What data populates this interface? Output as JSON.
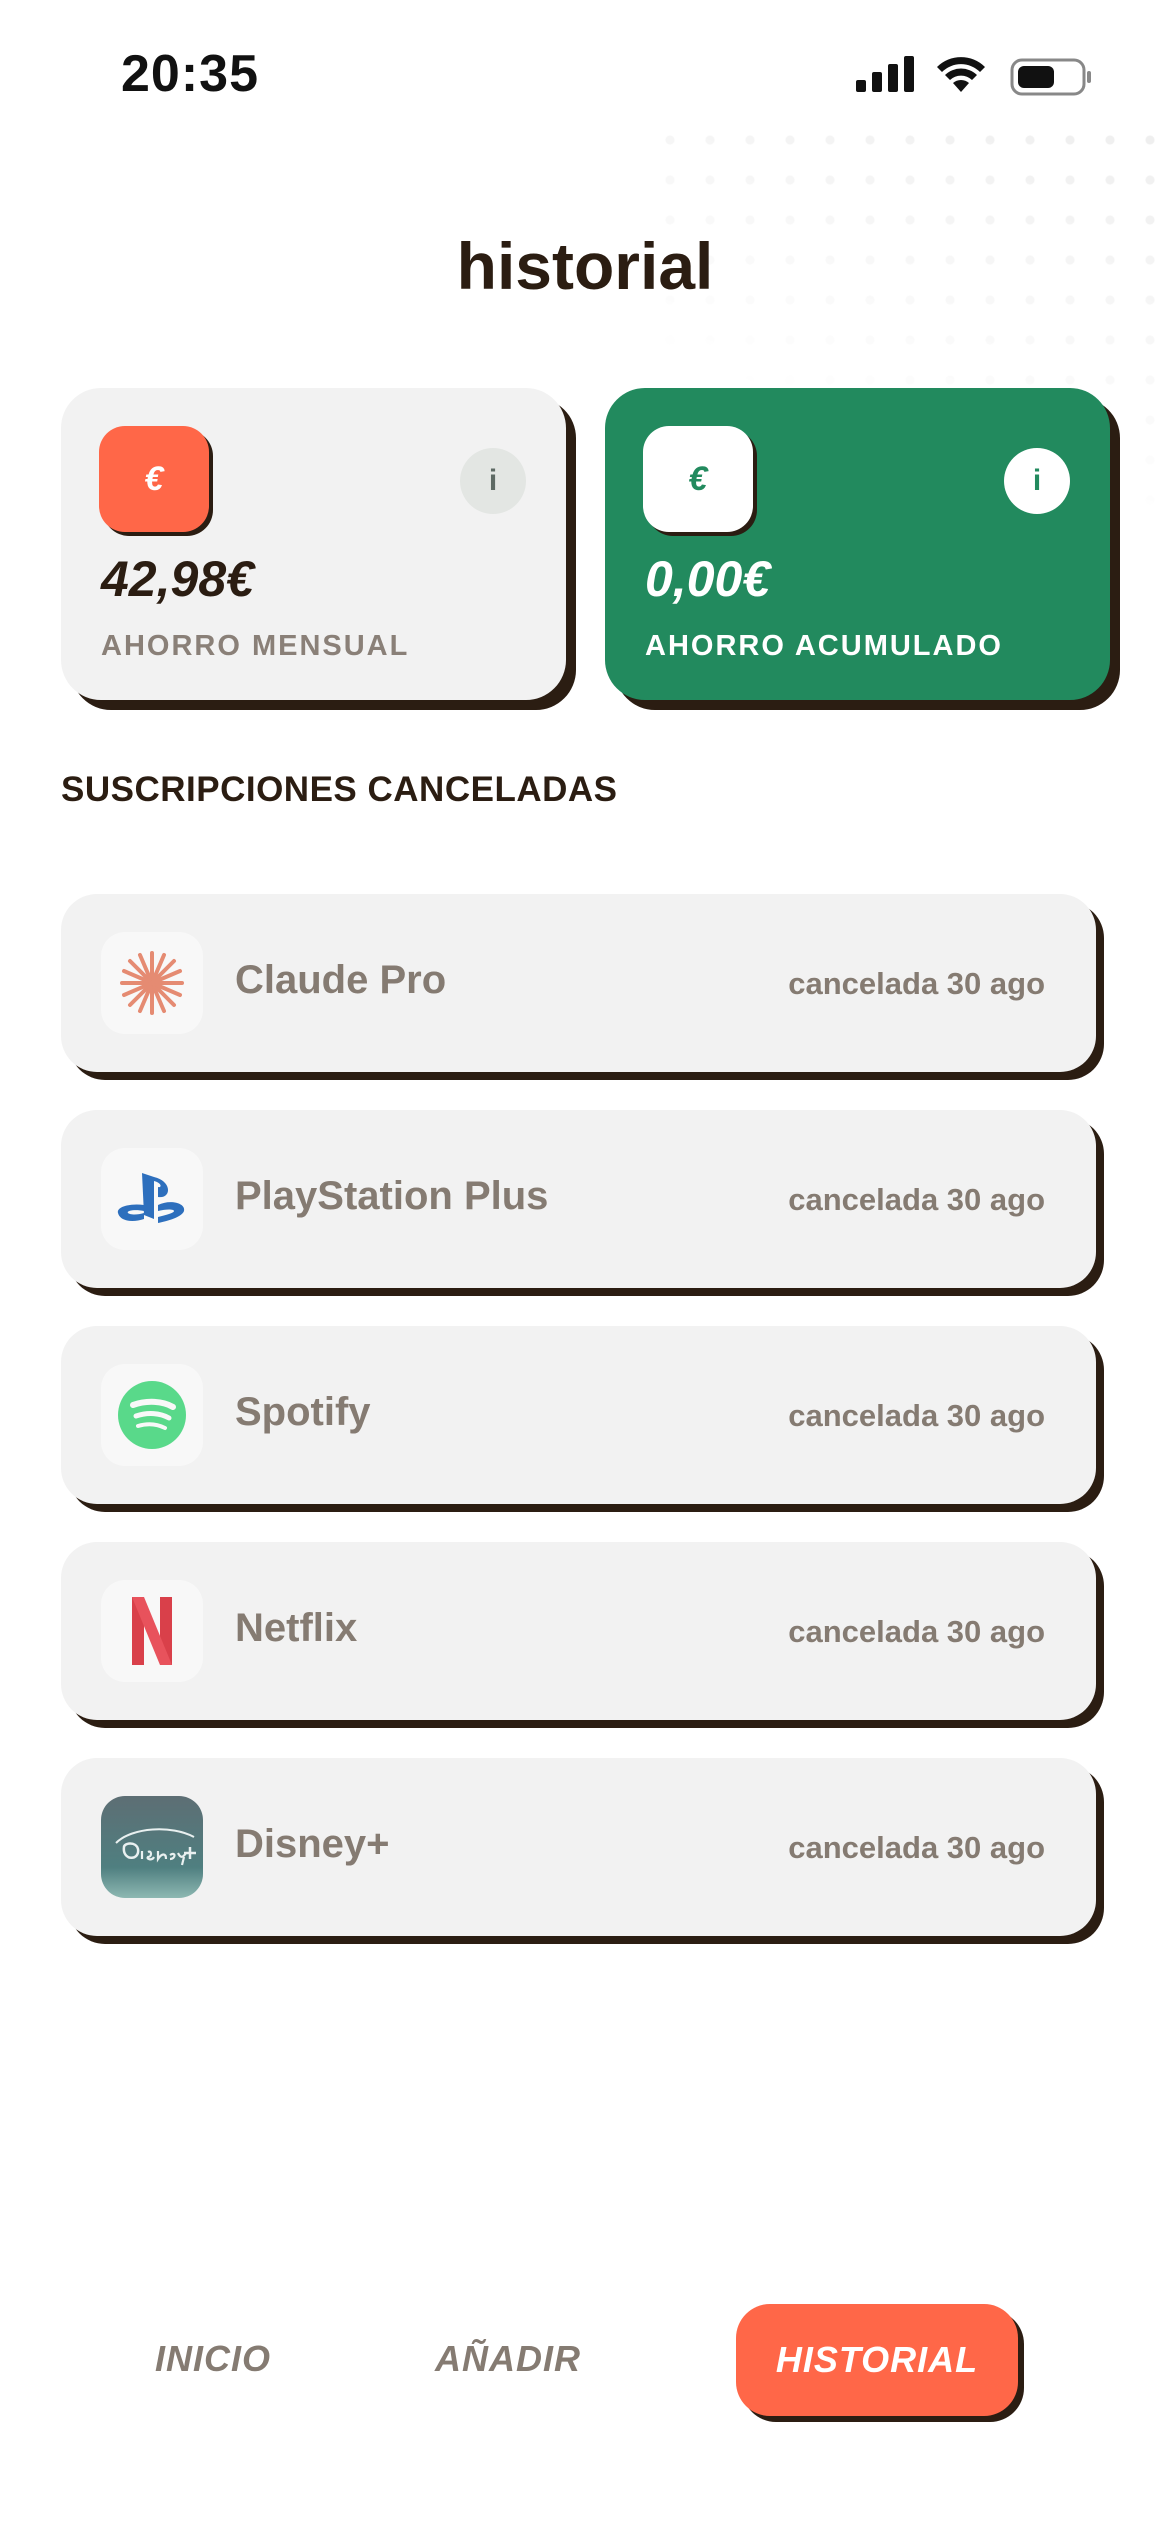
{
  "status_bar": {
    "time": "20:35"
  },
  "header": {
    "title": "historial"
  },
  "stats": {
    "monthly": {
      "icon": "€",
      "info_icon": "i",
      "amount": "42,98€",
      "label": "AHORRO MENSUAL"
    },
    "accumulated": {
      "icon": "€",
      "info_icon": "i",
      "amount": "0,00€",
      "label": "AHORRO ACUMULADO"
    }
  },
  "section_title": "SUSCRIPCIONES CANCELADAS",
  "subscriptions": [
    {
      "name": "Claude Pro",
      "status": "cancelada 30 ago",
      "icon": "claude-logo-icon"
    },
    {
      "name": "PlayStation Plus",
      "status": "cancelada 30 ago",
      "icon": "playstation-logo-icon"
    },
    {
      "name": "Spotify",
      "status": "cancelada 30 ago",
      "icon": "spotify-logo-icon"
    },
    {
      "name": "Netflix",
      "status": "cancelada 30 ago",
      "icon": "netflix-logo-icon"
    },
    {
      "name": "Disney+",
      "status": "cancelada 30 ago",
      "icon": "disney-plus-logo-icon"
    }
  ],
  "nav": {
    "inicio": "INICIO",
    "anadir": "AÑADIR",
    "historial": "HISTORIAL"
  },
  "colors": {
    "accent": "#ff6748",
    "green": "#228a5e",
    "ink": "#2b1d12",
    "card": "#f2f2f2"
  }
}
